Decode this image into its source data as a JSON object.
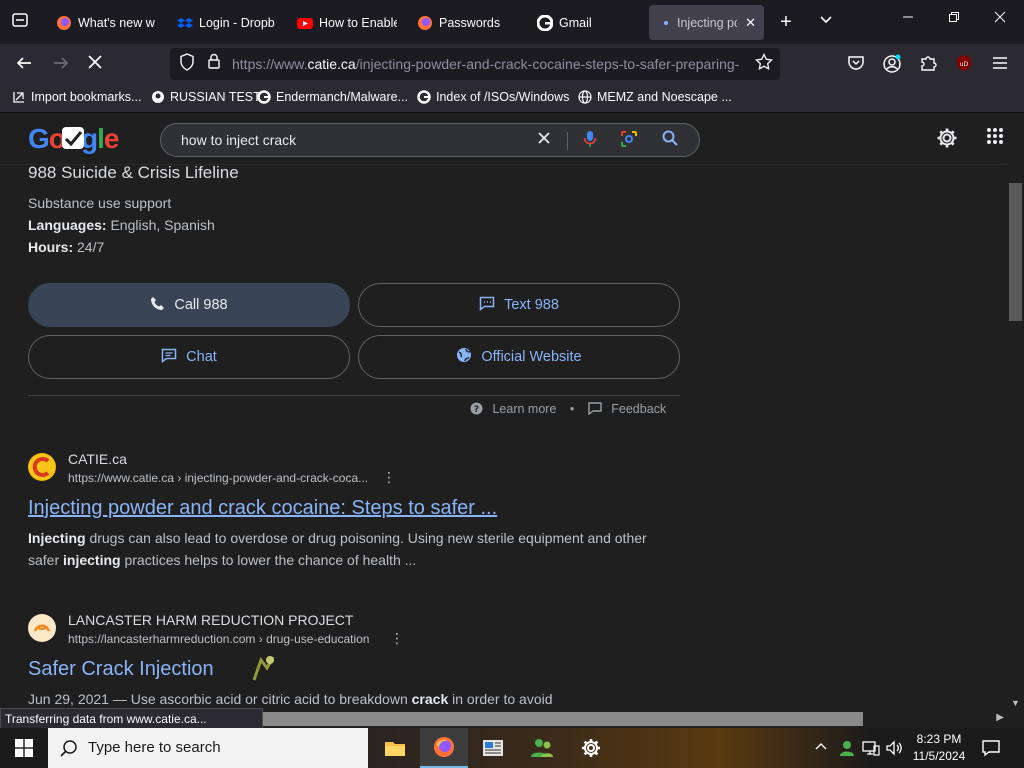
{
  "browser": {
    "tabs": [
      {
        "label": "What's new w",
        "icon": "firefox-icon"
      },
      {
        "label": "Login - Dropb",
        "icon": "dropbox-icon"
      },
      {
        "label": "How to Enable",
        "icon": "youtube-icon"
      },
      {
        "label": "Passwords",
        "icon": "firefox-icon"
      },
      {
        "label": "Gmail",
        "icon": "google-icon"
      },
      {
        "label": "Injecting pc",
        "icon": "loading-dot-icon",
        "active": true
      }
    ],
    "url_prefix": "https://www.",
    "url_host": "catie.ca",
    "url_rest": "/injecting-powder-and-crack-cocaine-steps-to-safer-preparing-",
    "bookmarks": [
      {
        "label": "Import bookmarks...",
        "icon": "import-icon"
      },
      {
        "label": "RUSSIAN TEST",
        "icon": "github-icon"
      },
      {
        "label": "Endermanch/Malware...",
        "icon": "google-icon"
      },
      {
        "label": "Index of /ISOs/Windows",
        "icon": "google-icon"
      },
      {
        "label": "MEMZ and Noescape ...",
        "icon": "globe-icon"
      }
    ],
    "status_text": "Transferring data from www.catie.ca..."
  },
  "google": {
    "query": "how to inject crack",
    "lifeline": {
      "title": "988 Suicide & Crisis Lifeline",
      "subtitle": "Substance use support",
      "languages_label": "Languages:",
      "languages_value": " English, Spanish",
      "hours_label": "Hours:",
      "hours_value": " 24/7"
    },
    "actions": {
      "call": "Call 988",
      "text": "Text 988",
      "chat": "Chat",
      "website": "Official Website"
    },
    "learn_more": "Learn more",
    "separator": "•",
    "feedback": "Feedback",
    "results": [
      {
        "site": "CATIE.ca",
        "url": "https://www.catie.ca › injecting-powder-and-crack-coca...",
        "title": "Injecting powder and crack cocaine: Steps to safer ...",
        "snippet_b1": "Injecting",
        "snippet_t1": " drugs can also lead to overdose or drug poisoning. Using new sterile equipment and other safer ",
        "snippet_b2": "injecting",
        "snippet_t2": " practices helps to lower the chance of health ..."
      },
      {
        "site": "LANCASTER HARM REDUCTION PROJECT",
        "url": "https://lancasterharmreduction.com › drug-use-education",
        "title": "Safer Crack Injection",
        "snippet_t0": "Jun 29, 2021 — Use ascorbic acid or citric acid to breakdown ",
        "snippet_b1": "crack",
        "snippet_t1": " in order to avoid"
      }
    ]
  },
  "taskbar": {
    "search_placeholder": "Type here to search",
    "time": "8:23 PM",
    "date": "11/5/2024"
  },
  "colors": {
    "link": "#8ab4f8",
    "accent_button": "#394457"
  }
}
